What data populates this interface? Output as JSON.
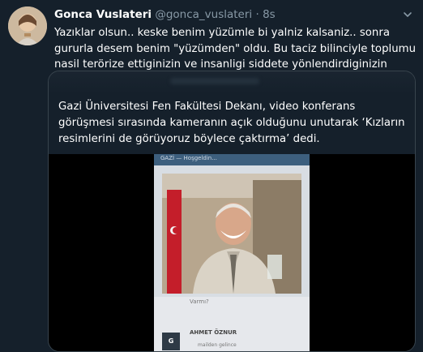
{
  "tweet": {
    "display_name": "Gonca Vuslateri",
    "handle": "@gonca_vuslateri",
    "separator": "·",
    "time": "8s",
    "text": "Yazıklar olsun.. keske benim yüzümle bi yalniz kalsaniz.. sonra gururla desem benim \"yüzümden\" oldu. Bu taciz bilinciyle toplumu nasil terörize ettiginizin ve insanligi siddete yönlendirdiginizin hesabini verirsiniz umarim."
  },
  "quoted": {
    "text": "Gazi Üniversitesi Fen Fakültesi Dekanı, video konferans görüşmesi sırasında kameranın açık olduğunu unutarak ‘Kızların resimlerini de görüyoruz böylece çaktırma’ dedi."
  },
  "video": {
    "top_bar_text": "GAZİ — Hoşgeldin...",
    "chat_label": "Varmı?",
    "avatar_letter": "G",
    "participant_name": "AHMET ÖZNUR",
    "participant_sub": "mailden gelince"
  },
  "icons": {
    "menu": "chevron-down-icon",
    "avatar": "avatar"
  }
}
